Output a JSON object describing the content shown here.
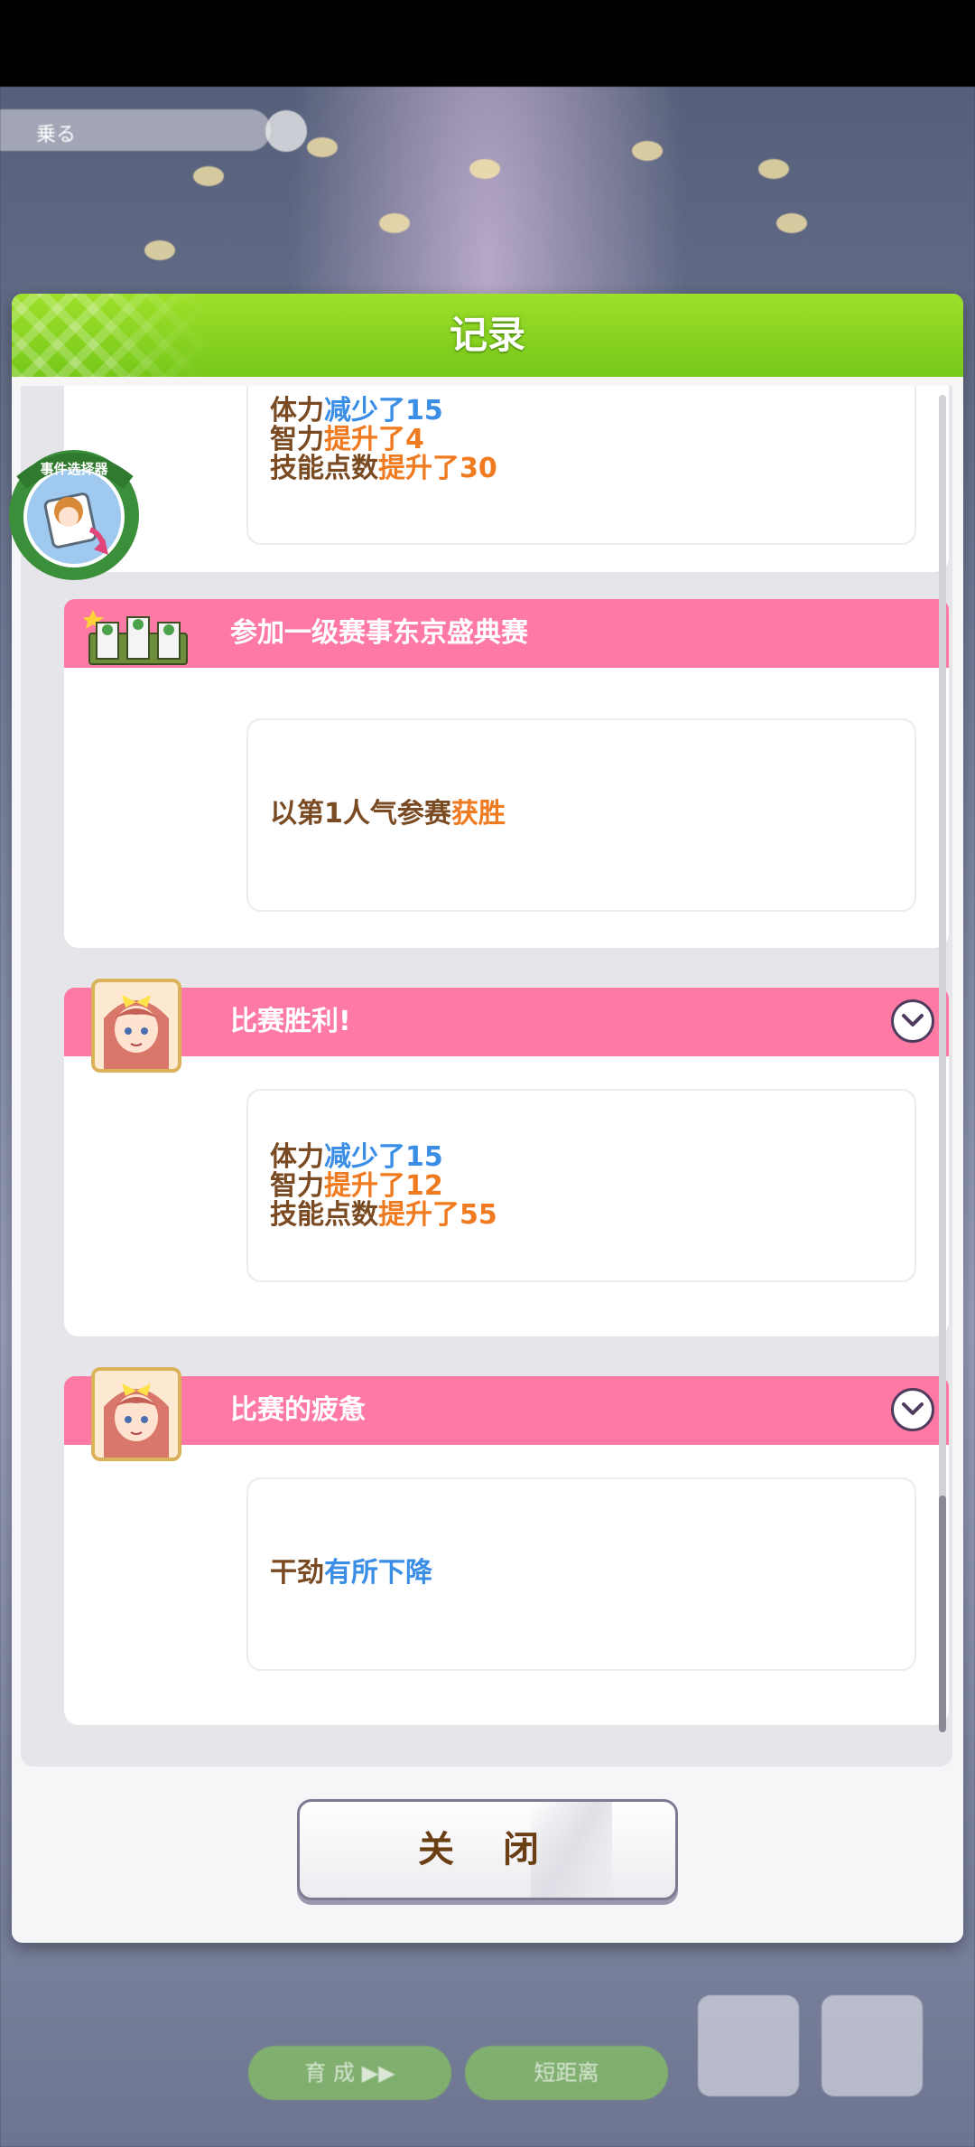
{
  "background": {
    "chip_text": "乗る",
    "bottom_left_text": "育 成 ▶▶",
    "bottom_mid_text": "短距离"
  },
  "dialog": {
    "title": "记录",
    "close_label": "关 闭",
    "badge_text": "事件选择器"
  },
  "cards": [
    {
      "title": "",
      "effects": [
        {
          "parts": [
            {
              "t": "体力",
              "c": "brown"
            },
            {
              "t": "减少了15",
              "c": "blue"
            }
          ]
        },
        {
          "parts": [
            {
              "t": "智力",
              "c": "brown"
            },
            {
              "t": "提升了4",
              "c": "orange"
            }
          ]
        },
        {
          "parts": [
            {
              "t": "技能点数",
              "c": "brown"
            },
            {
              "t": "提升了30",
              "c": "orange"
            }
          ]
        }
      ]
    },
    {
      "title": "参加一级赛事东京盛典赛",
      "effects": [
        {
          "parts": [
            {
              "t": "以第1人气参赛",
              "c": "brown"
            },
            {
              "t": "获胜",
              "c": "orange"
            }
          ]
        }
      ]
    },
    {
      "title": "比赛胜利!",
      "effects": [
        {
          "parts": [
            {
              "t": "体力",
              "c": "brown"
            },
            {
              "t": "减少了15",
              "c": "blue"
            }
          ]
        },
        {
          "parts": [
            {
              "t": "智力",
              "c": "brown"
            },
            {
              "t": "提升了12",
              "c": "orange"
            }
          ]
        },
        {
          "parts": [
            {
              "t": "技能点数",
              "c": "brown"
            },
            {
              "t": "提升了55",
              "c": "orange"
            }
          ]
        }
      ]
    },
    {
      "title": "比赛的疲惫",
      "effects": [
        {
          "parts": [
            {
              "t": "干劲",
              "c": "brown"
            },
            {
              "t": "有所下降",
              "c": "blue"
            }
          ]
        }
      ]
    }
  ],
  "colors": {
    "header_green": "#77c81a",
    "card_pink": "#fe7aa4",
    "text_brown": "#7a4a22",
    "text_blue": "#3a8ee6",
    "text_orange": "#f07a20"
  }
}
